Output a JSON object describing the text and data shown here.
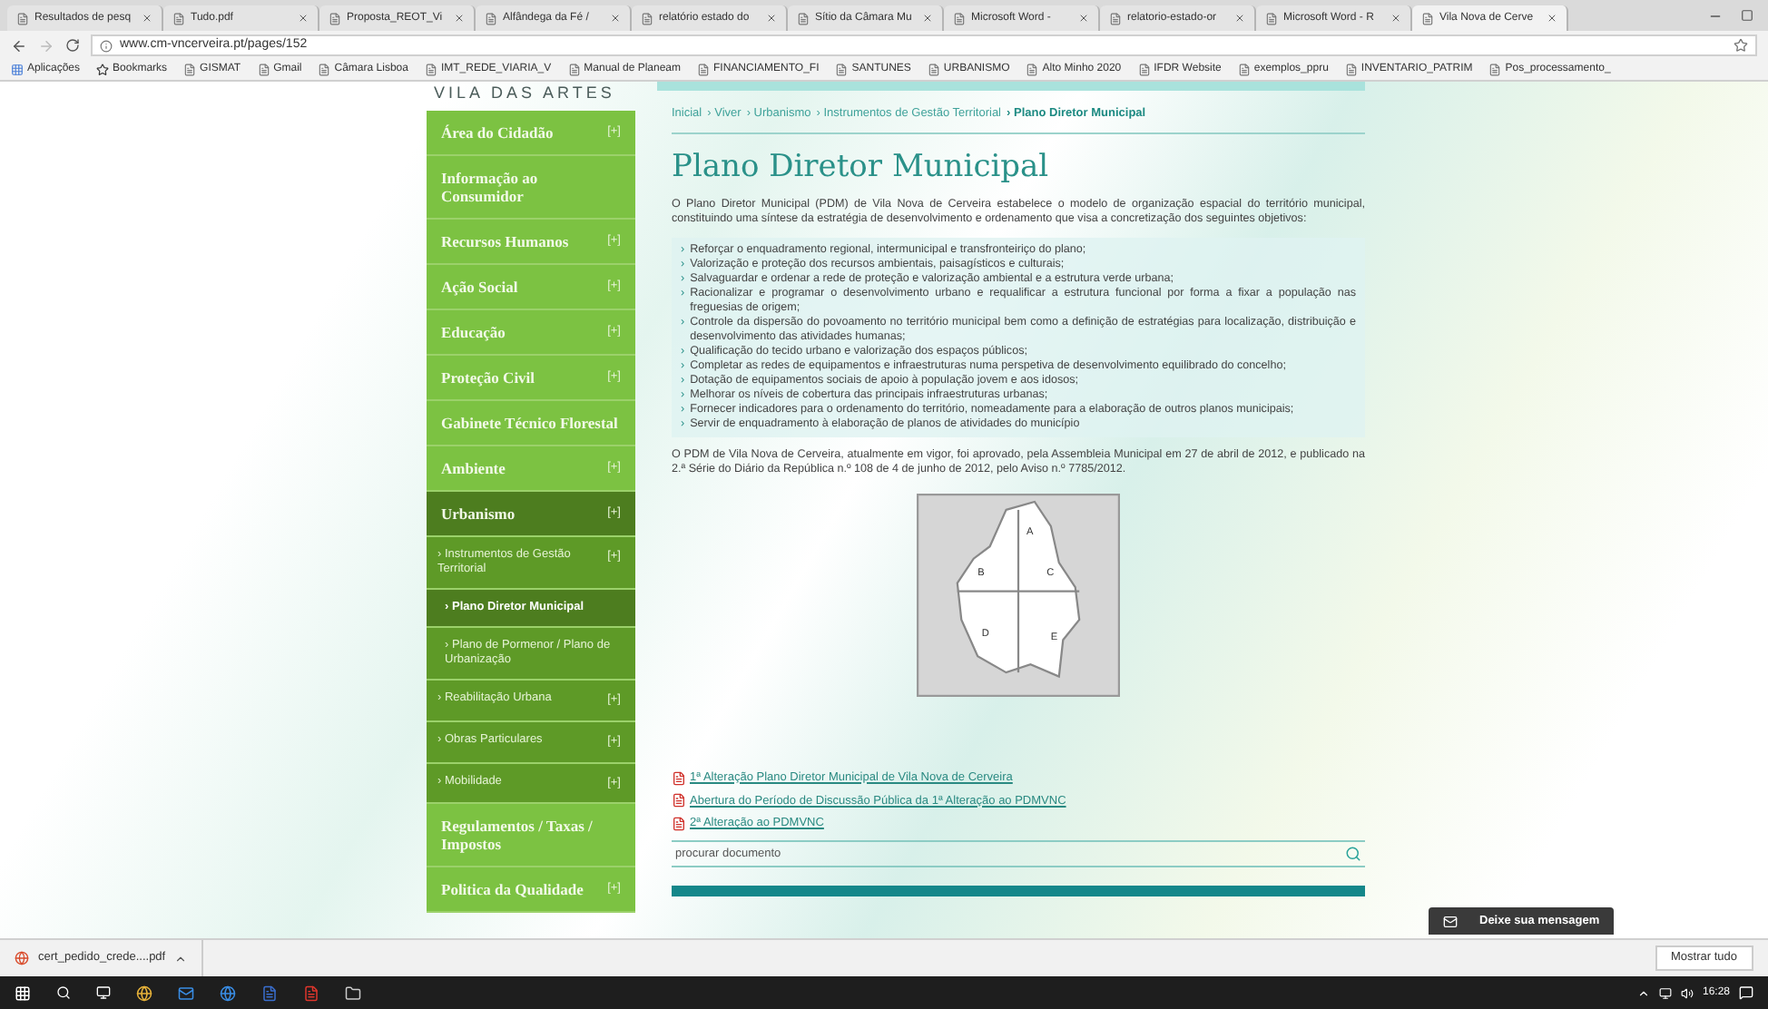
{
  "browser": {
    "tabs": [
      {
        "title": "Resultados de pesq",
        "selected": false
      },
      {
        "title": "Tudo.pdf",
        "selected": false
      },
      {
        "title": "Proposta_REOT_Vi",
        "selected": false
      },
      {
        "title": "Alfândega da Fé / ",
        "selected": false
      },
      {
        "title": "relatório estado do",
        "selected": false
      },
      {
        "title": "Sítio da Câmara Mu",
        "selected": false
      },
      {
        "title": "Microsoft Word - ",
        "selected": false
      },
      {
        "title": "relatorio-estado-or",
        "selected": false
      },
      {
        "title": "Microsoft Word - R",
        "selected": false
      },
      {
        "title": "Vila Nova de Cerve",
        "selected": true
      }
    ],
    "url": "www.cm-vncerveira.pt/pages/152",
    "bookmarks": [
      "Aplicações",
      "Bookmarks",
      "GISMAT",
      "Gmail",
      "Câmara Lisboa",
      "IMT_REDE_VIARIA_V",
      "Manual de Planeam",
      "FINANCIAMENTO_FI",
      "SANTUNES",
      "URBANISMO",
      "Alto Minho 2020",
      "IFDR Website",
      "exemplos_ppru",
      "INVENTARIO_PATRIM",
      "Pos_processamento_"
    ]
  },
  "site": {
    "logo_text": "VILA DAS ARTES"
  },
  "sidebar": {
    "items": [
      {
        "label": "Área do Cidadão",
        "expander": "[+]",
        "selected": false
      },
      {
        "label": "Informação ao Consumidor",
        "selected": false
      },
      {
        "label": "Recursos Humanos",
        "expander": "[+]",
        "selected": false
      },
      {
        "label": "Ação Social",
        "expander": "[+]",
        "selected": false
      },
      {
        "label": "Educação",
        "expander": "[+]",
        "selected": false
      },
      {
        "label": "Proteção Civil",
        "expander": "[+]",
        "selected": false
      },
      {
        "label": "Gabinete Técnico Florestal",
        "selected": false
      },
      {
        "label": "Ambiente",
        "expander": "[+]",
        "selected": false
      },
      {
        "label": "Urbanismo",
        "expander": "[+]",
        "selected": true,
        "children": [
          {
            "marker": "›",
            "label": "Instrumentos de Gestão Territorial",
            "expander": "[+]",
            "selected": false,
            "children": [
              {
                "marker": "›",
                "label": "Plano Diretor Municipal",
                "selected": true
              },
              {
                "marker": "›",
                "label": "Plano de Pormenor / Plano de Urbanização",
                "selected": false
              }
            ]
          },
          {
            "marker": "›",
            "label": "Reabilitação Urbana",
            "expander": "[+]",
            "selected": false
          },
          {
            "marker": "›",
            "label": "Obras Particulares",
            "expander": "[+]",
            "selected": false
          },
          {
            "marker": "›",
            "label": "Mobilidade",
            "expander": "[+]",
            "selected": false
          }
        ]
      },
      {
        "label": "Regulamentos / Taxas / Impostos",
        "selected": false
      },
      {
        "label": "Politica da Qualidade",
        "expander": "[+]",
        "selected": false
      }
    ]
  },
  "breadcrumb": [
    {
      "label": "Inicial"
    },
    {
      "separator": "›",
      "label": "Viver"
    },
    {
      "separator": "›",
      "label": "Urbanismo"
    },
    {
      "separator": "›",
      "label": "Instrumentos de Gestão Territorial"
    },
    {
      "separator": "›",
      "label": "Plano Diretor Municipal"
    }
  ],
  "page_title": "Plano Diretor Municipal",
  "intro": "O Plano Diretor Municipal (PDM) de Vila Nova de Cerveira estabelece o modelo de organização espacial do território municipal, constituindo uma síntese da estratégia de desenvolvimento e ordenamento que visa a concretização dos seguintes objetivos:",
  "objectives": [
    {
      "bullet": "›",
      "text": "Reforçar o enquadramento regional, intermunicipal e transfronteiriço do plano;"
    },
    {
      "bullet": "›",
      "text": "Valorização e proteção dos recursos ambientais, paisagísticos e culturais;"
    },
    {
      "bullet": "›",
      "text": "Salvaguardar e ordenar a rede de proteção e valorização ambiental e a estrutura verde urbana;"
    },
    {
      "bullet": "›",
      "text": "Racionalizar e programar o desenvolvimento urbano e requalificar a estrutura funcional por forma a fixar a população nas freguesias de origem;"
    },
    {
      "bullet": "›",
      "text": "Controle da dispersão do povoamento no território municipal bem como a definição de estratégias para localização, distribuição e desenvolvimento das atividades humanas;"
    },
    {
      "bullet": "›",
      "text": "Qualificação do tecido urbano e valorização dos espaços públicos;"
    },
    {
      "bullet": "›",
      "text": "Completar as redes de equipamentos e infraestruturas numa perspetiva de desenvolvimento equilibrado do concelho;"
    },
    {
      "bullet": "›",
      "text": "Dotação de equipamentos sociais de apoio à população jovem e aos idosos;"
    },
    {
      "bullet": "›",
      "text": "Melhorar os níveis de cobertura das principais infraestruturas urbanas;"
    },
    {
      "bullet": "›",
      "text": "Fornecer indicadores para o ordenamento do território, nomeadamente para a elaboração de outros planos municipais;"
    },
    {
      "bullet": "›",
      "text": "Servir de enquadramento à elaboração de planos de atividades do município"
    }
  ],
  "approval_text": "O PDM de Vila Nova de Cerveira, atualmente em vigor, foi aprovado, pela Assembleia Municipal em 27 de abril de 2012, e publicado na 2.ª Série do Diário da República n.º 108 de 4 de junho de 2012, pelo Aviso  n.º 7785/2012.",
  "map_labels": [
    "A",
    "B",
    "C",
    "D",
    "E"
  ],
  "documents": [
    "1ª Alteração Plano Diretor Municipal de Vila Nova de Cerveira",
    "Abertura do Período de Discussão Pública da 1ª Alteração ao PDMVNC",
    "2ª Alteração ao PDMVNC"
  ],
  "doc_search": {
    "placeholder": "procurar documento"
  },
  "message_button": "Deixe sua mensagem",
  "downloads": {
    "file": "cert_pedido_crede....pdf",
    "show_all": "Mostrar tudo"
  },
  "taskbar": {
    "time": "16:28"
  }
}
